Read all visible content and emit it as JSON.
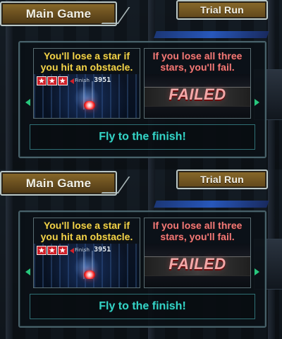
{
  "screens": [
    {
      "tabs": {
        "main_label": "Main Game",
        "trial_label": "Trial Run"
      },
      "cards": [
        {
          "caption": "You'll lose a star if you hit an obstacle.",
          "stars_remaining": 3,
          "finish_label": "Finish",
          "finish_value": "3951"
        },
        {
          "caption": "If you lose all three stars, you'll fail.",
          "status_text": "FAILED"
        }
      ],
      "footer_text": "Fly to the finish!"
    },
    {
      "tabs": {
        "main_label": "Main Game",
        "trial_label": "Trial Run"
      },
      "cards": [
        {
          "caption": "You'll lose a star if you hit an obstacle.",
          "stars_remaining": 3,
          "finish_label": "Finish",
          "finish_value": "3951"
        },
        {
          "caption": "If you lose all three stars, you'll fail.",
          "status_text": "FAILED"
        }
      ],
      "footer_text": "Fly to the finish!"
    }
  ],
  "icons": {
    "nav_left": "chevron-left-icon",
    "nav_right": "chevron-right-icon",
    "star": "star-icon",
    "ship": "ship-icon"
  },
  "colors": {
    "caption_yellow": "#f0d24b",
    "caption_red": "#f07a78",
    "footer_teal": "#35d2c5",
    "panel_border": "#48616a",
    "tab_gold": "#8a6b2b"
  }
}
